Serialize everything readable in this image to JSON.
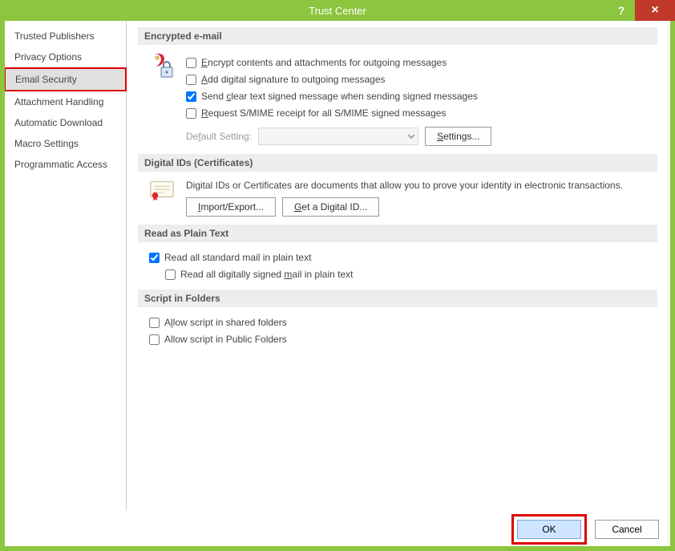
{
  "window": {
    "title": "Trust Center",
    "help": "?",
    "close": "×"
  },
  "sidebar": {
    "items": [
      {
        "label": "Trusted Publishers",
        "selected": false
      },
      {
        "label": "Privacy Options",
        "selected": false
      },
      {
        "label": "Email Security",
        "selected": true
      },
      {
        "label": "Attachment Handling",
        "selected": false
      },
      {
        "label": "Automatic Download",
        "selected": false
      },
      {
        "label": "Macro Settings",
        "selected": false
      },
      {
        "label": "Programmatic Access",
        "selected": false
      }
    ]
  },
  "sections": {
    "encrypted": {
      "title": "Encrypted e-mail",
      "opt1": "Encrypt contents and attachments for outgoing messages",
      "opt2": "Add digital signature to outgoing messages",
      "opt3": "Send clear text signed message when sending signed messages",
      "opt4": "Request S/MIME receipt for all S/MIME signed messages",
      "defaultSettingLabel": "Default Setting:",
      "settingsBtn": "Settings..."
    },
    "digital": {
      "title": "Digital IDs (Certificates)",
      "desc": "Digital IDs or Certificates are documents that allow you to prove your identity in electronic transactions.",
      "importBtn": "Import/Export...",
      "getBtn": "Get a Digital ID..."
    },
    "plain": {
      "title": "Read as Plain Text",
      "opt1": "Read all standard mail in plain text",
      "opt2": "Read all digitally signed mail in plain text"
    },
    "script": {
      "title": "Script in Folders",
      "opt1": "Allow script in shared folders",
      "opt2": "Allow script in Public Folders"
    }
  },
  "footer": {
    "ok": "OK",
    "cancel": "Cancel"
  }
}
